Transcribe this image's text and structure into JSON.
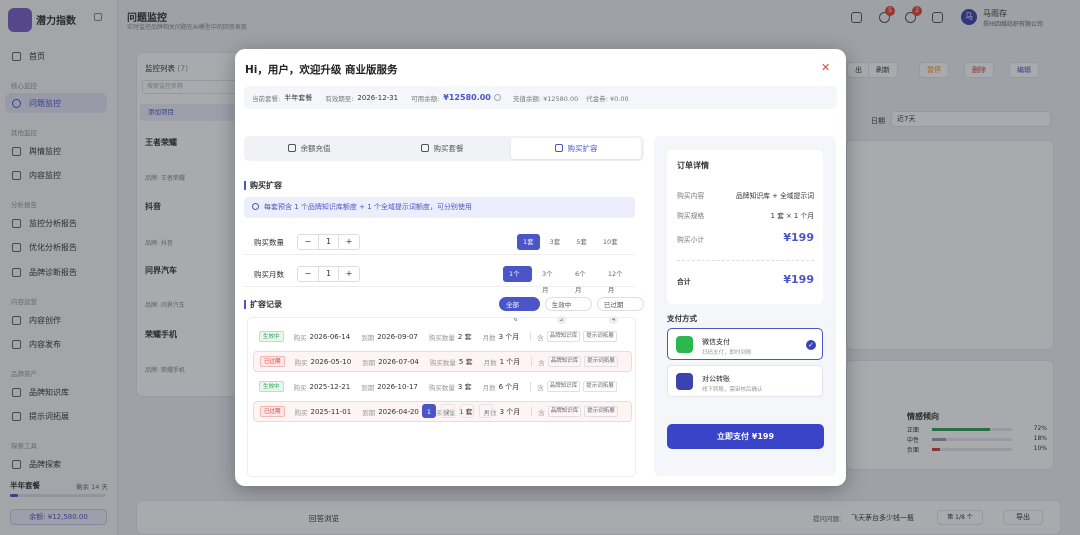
{
  "app": {
    "name": "潜力指数"
  },
  "sidebar": {
    "items": [
      {
        "label": "首页"
      },
      {
        "group": "核心监控"
      },
      {
        "label": "问题监控",
        "active": true
      },
      {
        "group": "其他监控"
      },
      {
        "label": "舆情监控"
      },
      {
        "label": "内容监控"
      },
      {
        "group": "分析报告"
      },
      {
        "label": "监控分析报告"
      },
      {
        "label": "优化分析报告"
      },
      {
        "label": "品牌诊断报告"
      },
      {
        "group": "内容运营"
      },
      {
        "label": "内容创作"
      },
      {
        "label": "内容发布"
      },
      {
        "group": "品牌资产"
      },
      {
        "label": "品牌知识库"
      },
      {
        "label": "提示词拓展"
      },
      {
        "group": "探索工具"
      },
      {
        "label": "品牌探索"
      }
    ],
    "plan_name": "半年套餐",
    "plan_days": "剩余 14 天",
    "plan_progress": 0.08,
    "balance_button": "余额: ¥12,580.00"
  },
  "header": {
    "title": "问题监控",
    "subtitle": "实时监控品牌相关问题在AI模型中的回答表现",
    "badge_1": "5",
    "badge_2": "2",
    "user_avatar": "马",
    "user_name": "马雨存",
    "user_company": "郑州四维纺织有限公司"
  },
  "background": {
    "list_title": "监控列表",
    "list_count": "(7)",
    "search_placeholder": "搜索监控名称",
    "add_item": "添加项目",
    "brands": [
      {
        "name": "王者荣耀",
        "tag": "品牌: 王者荣耀"
      },
      {
        "name": "抖音",
        "tag": "品牌: 抖音"
      },
      {
        "name": "问界汽车",
        "tag": "品牌: 问界汽车"
      },
      {
        "name": "荣耀手机",
        "tag": "品牌: 荣耀手机"
      }
    ],
    "btn_out": "出",
    "btn_refresh": "刷新",
    "btn_pause": "暂停",
    "btn_delete": "删除",
    "btn_edit": "编辑",
    "date_label": "日期",
    "date_value": "近7天",
    "sentiment_title": "情感倾向",
    "sentiment": [
      {
        "label": "正面",
        "pct": "72%",
        "fill": 0.72,
        "color": "#2d9f56"
      },
      {
        "label": "中性",
        "pct": "18%",
        "fill": 0.18,
        "color": "#9aa0ad"
      },
      {
        "label": "负面",
        "pct": "10%",
        "fill": 0.1,
        "color": "#d23c3c"
      }
    ],
    "bottom_left": "回答浏览",
    "bottom_q": "提问问题:",
    "bottom_q_text": "飞天茅台多少钱一瓶",
    "bottom_page": "第 1/8 个",
    "bottom_export": "导出"
  },
  "modal": {
    "title": "Hi，用户，欢迎升级 商业版服务",
    "info": {
      "plan_label": "当前套餐:",
      "plan_value": "半年套餐",
      "expire_label": "有效期至:",
      "expire_value": "2026-12-31",
      "balance_label": "可用余额:",
      "balance_value": "¥12580.00",
      "recharge_label": "充值余额: ¥12580.00",
      "voucher_label": "代金券: ¥0.00"
    },
    "tabs": [
      "余额充值",
      "购买套餐",
      "购买扩容"
    ],
    "active_tab": 2,
    "section_buy": "购买扩容",
    "notice": "每套预含 1 个品牌知识库额度 + 1 个全域提示词额度，可分别使用",
    "qty_label": "购买数量",
    "qty_value": "1",
    "qty_options": [
      "1套",
      "3套",
      "5套",
      "10套"
    ],
    "months_label": "购买月数",
    "months_value": "1",
    "months_options": [
      "1个月",
      "3个月",
      "6个月",
      "12个月"
    ],
    "section_records": "扩容记录",
    "filters": [
      {
        "label": "全部",
        "count": "6"
      },
      {
        "label": "生效中",
        "count": "2"
      },
      {
        "label": "已过期",
        "count": "4"
      }
    ],
    "records": [
      {
        "status": "生效中",
        "active": true,
        "buy": "2026-06-14",
        "expire": "2026-09-07",
        "qty": "2 套",
        "months": "3 个月"
      },
      {
        "status": "已过期",
        "active": false,
        "buy": "2026-05-10",
        "expire": "2026-07-04",
        "qty": "5 套",
        "months": "1 个月"
      },
      {
        "status": "生效中",
        "active": true,
        "buy": "2025-12-21",
        "expire": "2026-10-17",
        "qty": "3 套",
        "months": "6 个月"
      },
      {
        "status": "已过期",
        "active": false,
        "buy": "2025-11-01",
        "expire": "2026-04-20",
        "qty": "1 套",
        "months": "3 个月"
      }
    ],
    "rec_labels": {
      "buy": "购买",
      "expire": "到期",
      "qty": "购买数量",
      "months": "月数",
      "incl": "含",
      "tag1": "品牌知识库",
      "tag2": "提示词拓展"
    },
    "pager": {
      "prev2": "«",
      "prev": "‹",
      "pages": [
        "1",
        "2"
      ],
      "next": "›",
      "next2": "»"
    },
    "order": {
      "title": "订单详情",
      "content_label": "购买内容",
      "content_value": "品牌知识库 + 全域提示词",
      "spec_label": "购买规格",
      "spec_value": "1 套 × 1 个月",
      "subtotal_label": "购买小计",
      "subtotal_value": "¥199",
      "total_label": "合计",
      "total_value": "¥199"
    },
    "payment_title": "支付方式",
    "payments": [
      {
        "name": "微信支付",
        "sub": "扫码支付，即时到账",
        "color": "#2bb84f"
      },
      {
        "name": "对公转账",
        "sub": "线下转账，需审核后确认",
        "color": "#3a44b0"
      }
    ],
    "pay_button": "立即支付 ¥199"
  }
}
